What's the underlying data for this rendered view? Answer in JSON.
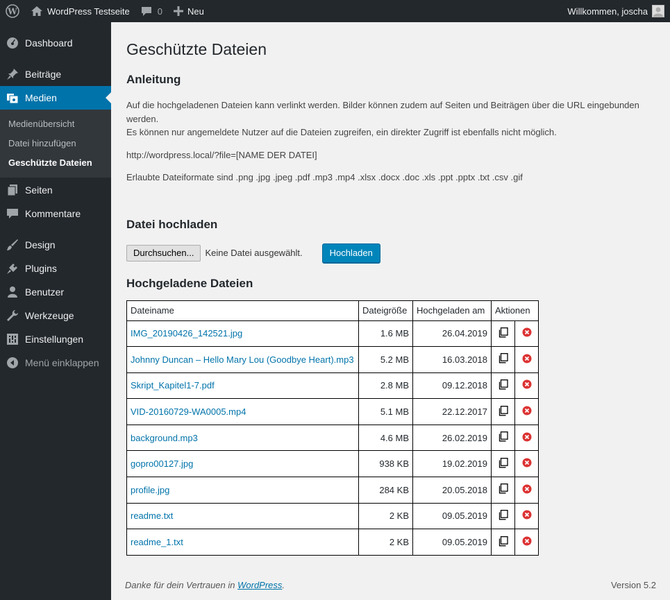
{
  "adminbar": {
    "site_name": "WordPress Testseite",
    "comments_count": "0",
    "new_label": "Neu",
    "welcome": "Willkommen, joscha"
  },
  "sidebar": {
    "items": [
      {
        "label": "Dashboard",
        "icon": "dashboard-icon"
      },
      {
        "label": "Beiträge",
        "icon": "pin-icon"
      },
      {
        "label": "Medien",
        "icon": "media-icon"
      },
      {
        "label": "Seiten",
        "icon": "pages-icon"
      },
      {
        "label": "Kommentare",
        "icon": "comment-icon"
      },
      {
        "label": "Design",
        "icon": "brush-icon"
      },
      {
        "label": "Plugins",
        "icon": "plugin-icon"
      },
      {
        "label": "Benutzer",
        "icon": "user-icon"
      },
      {
        "label": "Werkzeuge",
        "icon": "wrench-icon"
      },
      {
        "label": "Einstellungen",
        "icon": "settings-icon"
      },
      {
        "label": "Menü einklappen",
        "icon": "collapse-icon"
      }
    ],
    "submenu": [
      {
        "label": "Medienübersicht"
      },
      {
        "label": "Datei hinzufügen"
      },
      {
        "label": "Geschützte Dateien"
      }
    ]
  },
  "page": {
    "title": "Geschützte Dateien",
    "instructions_heading": "Anleitung",
    "instructions_line1": "Auf die hochgeladenen Dateien kann verlinkt werden. Bilder können zudem auf Seiten und Beiträgen über die URL eingebunden werden.",
    "instructions_line2": "Es können nur angemeldete Nutzer auf die Dateien zugreifen, ein direkter Zugriff ist ebenfalls nicht möglich.",
    "url_pattern": "http://wordpress.local/?file=[NAME DER DATEI]",
    "allowed_formats": "Erlaubte Dateiformate sind .png .jpg .jpeg .pdf .mp3 .mp4 .xlsx .docx .doc .xls .ppt .pptx .txt .csv .gif",
    "upload_heading": "Datei hochladen",
    "browse_label": "Durchsuchen...",
    "no_file_label": "Keine Datei ausgewählt.",
    "upload_button": "Hochladen",
    "files_heading": "Hochgeladene Dateien"
  },
  "table": {
    "headers": {
      "name": "Dateiname",
      "size": "Dateigröße",
      "date": "Hochgeladen am",
      "actions": "Aktionen"
    },
    "rows": [
      {
        "name": "IMG_20190426_142521.jpg",
        "size": "1.6 MB",
        "date": "26.04.2019"
      },
      {
        "name": "Johnny Duncan – Hello Mary Lou (Goodbye Heart).mp3",
        "size": "5.2 MB",
        "date": "16.03.2018"
      },
      {
        "name": "Skript_Kapitel1-7.pdf",
        "size": "2.8 MB",
        "date": "09.12.2018"
      },
      {
        "name": "VID-20160729-WA0005.mp4",
        "size": "5.1 MB",
        "date": "22.12.2017"
      },
      {
        "name": "background.mp3",
        "size": "4.6 MB",
        "date": "26.02.2019"
      },
      {
        "name": "gopro00127.jpg",
        "size": "938 KB",
        "date": "19.02.2019"
      },
      {
        "name": "profile.jpg",
        "size": "284 KB",
        "date": "20.05.2018"
      },
      {
        "name": "readme.txt",
        "size": "2 KB",
        "date": "09.05.2019"
      },
      {
        "name": "readme_1.txt",
        "size": "2 KB",
        "date": "09.05.2019"
      }
    ]
  },
  "footer": {
    "thanks_prefix": "Danke für dein Vertrauen in ",
    "thanks_link": "WordPress",
    "thanks_suffix": ".",
    "version": "Version 5.2"
  },
  "colors": {
    "accent": "#0073aa",
    "sidebar": "#23282d",
    "delete": "#dc3232"
  }
}
